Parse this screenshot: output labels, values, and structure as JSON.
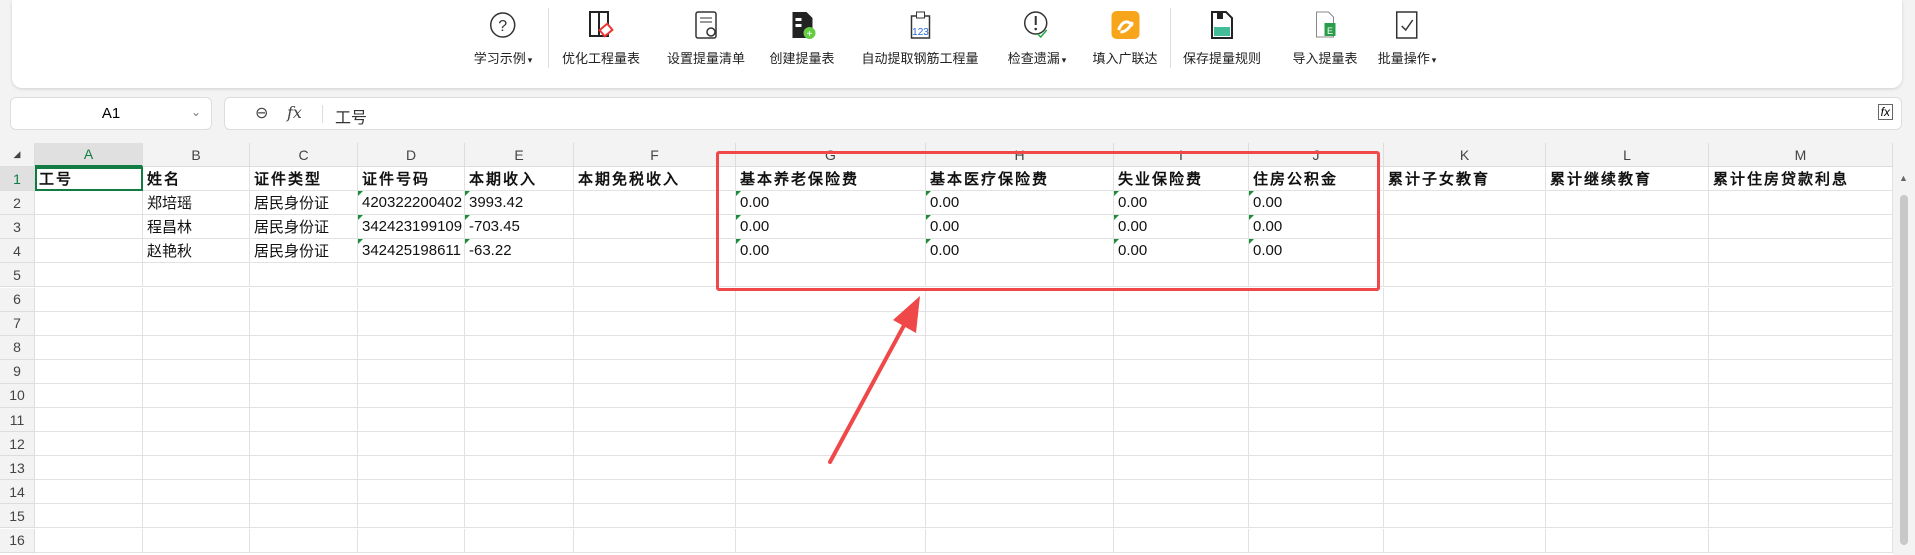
{
  "ribbon": {
    "buttons": [
      {
        "label": "学习示例",
        "icon": "help-circle-icon",
        "dropdown": true
      },
      {
        "label": "优化工程量表",
        "icon": "optimize-table-icon"
      },
      {
        "label": "设置提量清单",
        "icon": "settings-list-icon"
      },
      {
        "label": "创建提量表",
        "icon": "create-table-icon"
      },
      {
        "label": "自动提取钢筋工程量",
        "icon": "auto-extract-123-icon"
      },
      {
        "label": "检查遗漏",
        "icon": "check-missing-icon",
        "dropdown": true
      },
      {
        "label": "填入广联达",
        "icon": "glodon-logo-icon"
      },
      {
        "label": "保存提量规则",
        "icon": "save-rule-icon"
      },
      {
        "label": "导入提量表",
        "icon": "import-table-icon"
      },
      {
        "label": "批量操作",
        "icon": "batch-check-icon",
        "dropdown": true
      }
    ]
  },
  "name_box": {
    "value": "A1"
  },
  "formula_bar": {
    "fx": "fx",
    "value": "工号"
  },
  "columns": [
    "A",
    "B",
    "C",
    "D",
    "E",
    "F",
    "G",
    "H",
    "I",
    "J",
    "K",
    "L",
    "M"
  ],
  "rows": [
    "1",
    "2",
    "3",
    "4",
    "5",
    "6",
    "7",
    "8",
    "9",
    "10",
    "11",
    "12",
    "13",
    "14",
    "15",
    "16"
  ],
  "header_row": [
    "工号",
    "姓名",
    "证件类型",
    "证件号码",
    "本期收入",
    "本期免税收入",
    "基本养老保险费",
    "基本医疗保险费",
    "失业保险费",
    "住房公积金",
    "累计子女教育",
    "累计继续教育",
    "累计住房贷款利息"
  ],
  "data_rows": [
    [
      "",
      "郑培瑶",
      "居民身份证",
      "420322200402",
      "3993.42",
      "",
      "0.00",
      "0.00",
      "0.00",
      "0.00",
      "",
      "",
      ""
    ],
    [
      "",
      "程昌林",
      "居民身份证",
      "342423199109",
      "-703.45",
      "",
      "0.00",
      "0.00",
      "0.00",
      "0.00",
      "",
      "",
      ""
    ],
    [
      "",
      "赵艳秋",
      "居民身份证",
      "342425198611",
      "-63.22",
      "",
      "0.00",
      "0.00",
      "0.00",
      "0.00",
      "",
      "",
      ""
    ]
  ],
  "colors": {
    "annotation": "#f04848",
    "selection": "#107c41"
  }
}
